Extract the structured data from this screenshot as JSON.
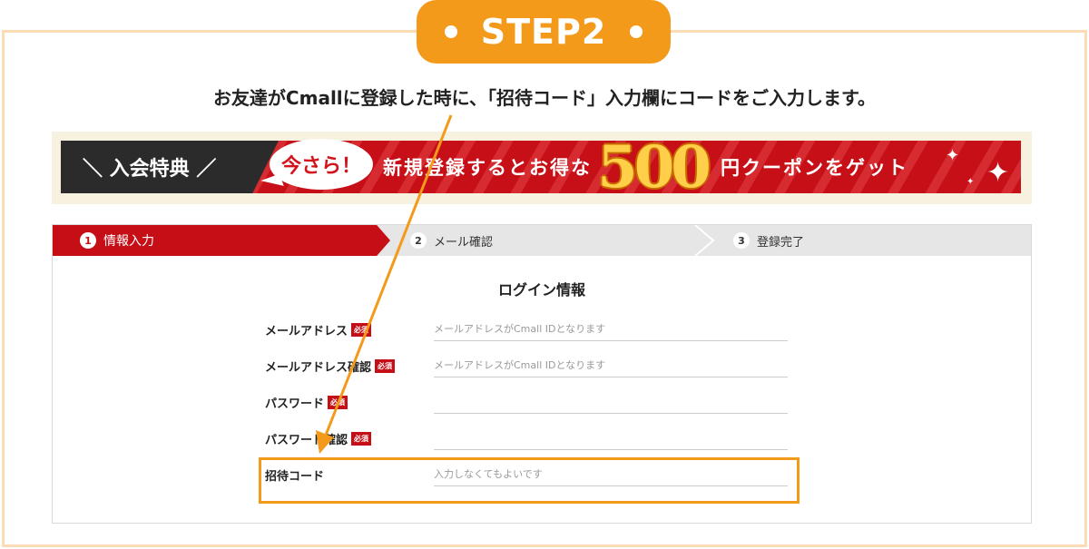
{
  "step_badge": {
    "label": "STEP2"
  },
  "instruction": "お友達がCmallに登録した時に、「招待コード」入力欄にコードをご入力します。",
  "banner": {
    "tag": "＼ 入会特典 ／",
    "bubble": "今さら！",
    "text_before": "新規登録するとお得な",
    "amount": "500",
    "text_after": "円クーポンをゲット"
  },
  "steps": [
    {
      "num": "1",
      "label": "情報入力"
    },
    {
      "num": "2",
      "label": "メール確認"
    },
    {
      "num": "3",
      "label": "登録完了"
    }
  ],
  "section_title": "ログイン情報",
  "required_badge": "必須",
  "fields": [
    {
      "label": "メールアドレス",
      "placeholder": "メールアドレスがCmall IDとなります",
      "required": true
    },
    {
      "label": "メールアドレス確認",
      "placeholder": "メールアドレスがCmall IDとなります",
      "required": true
    },
    {
      "label": "パスワード",
      "placeholder": "",
      "required": true
    },
    {
      "label": "パスワード確認",
      "placeholder": "",
      "required": true
    },
    {
      "label": "招待コード",
      "placeholder": "入力しなくてもよいです",
      "required": false
    }
  ],
  "colors": {
    "accent_orange": "#f49a1a",
    "brand_red": "#c50e16",
    "frame": "#fbdcb4"
  }
}
